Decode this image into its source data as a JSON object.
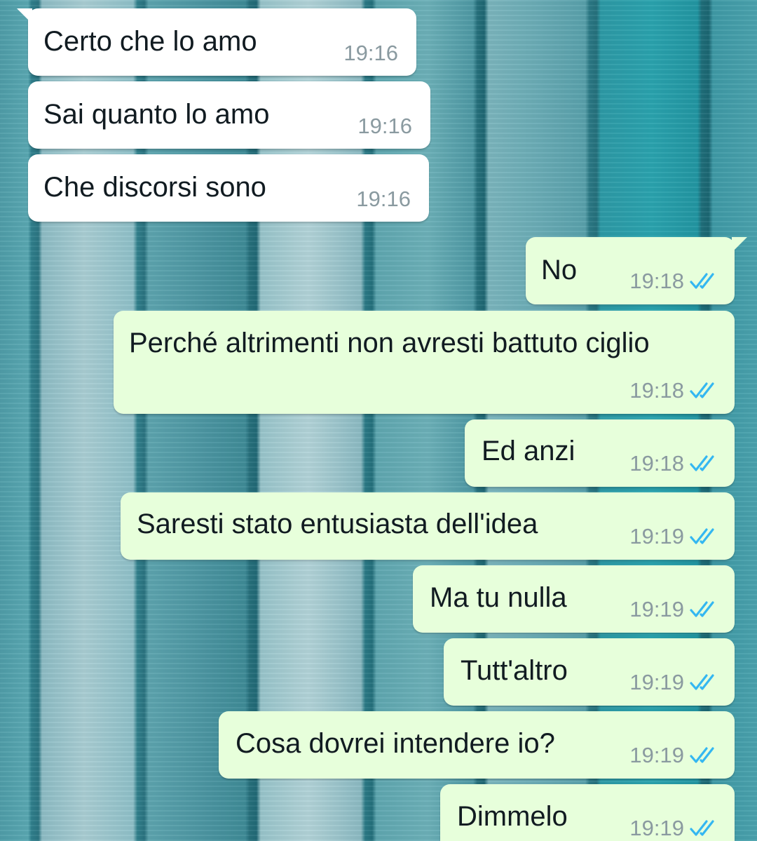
{
  "conversation": {
    "messages": [
      {
        "direction": "in",
        "text": "Certo che lo amo",
        "time": "19:16"
      },
      {
        "direction": "in",
        "text": "Sai quanto lo amo",
        "time": "19:16"
      },
      {
        "direction": "in",
        "text": "Che discorsi sono",
        "time": "19:16"
      },
      {
        "direction": "out",
        "text": "No",
        "time": "19:18",
        "status": "read",
        "status_icon": "double-check-icon",
        "status_color": "#34b7f1"
      },
      {
        "direction": "out",
        "text": "Perché altrimenti non avresti battuto ciglio",
        "time": "19:18",
        "status": "read",
        "status_icon": "double-check-icon",
        "status_color": "#34b7f1"
      },
      {
        "direction": "out",
        "text": "Ed anzi",
        "time": "19:18",
        "status": "read",
        "status_icon": "double-check-icon",
        "status_color": "#34b7f1"
      },
      {
        "direction": "out",
        "text": "Saresti stato entusiasta dell'idea",
        "time": "19:19",
        "status": "read",
        "status_icon": "double-check-icon",
        "status_color": "#34b7f1"
      },
      {
        "direction": "out",
        "text": "Ma tu nulla",
        "time": "19:19",
        "status": "read",
        "status_icon": "double-check-icon",
        "status_color": "#34b7f1"
      },
      {
        "direction": "out",
        "text": "Tutt'altro",
        "time": "19:19",
        "status": "read",
        "status_icon": "double-check-icon",
        "status_color": "#34b7f1"
      },
      {
        "direction": "out",
        "text": "Cosa dovrei intendere io?",
        "time": "19:19",
        "status": "read",
        "status_icon": "double-check-icon",
        "status_color": "#34b7f1"
      },
      {
        "direction": "out",
        "text": "Dimmelo",
        "time": "19:19",
        "status": "read",
        "status_icon": "double-check-icon",
        "status_color": "#34b7f1"
      }
    ]
  },
  "colors": {
    "incoming_bubble": "#ffffff",
    "outgoing_bubble": "#e7ffdb",
    "read_tick": "#34b7f1",
    "timestamp": "#8a9aa0",
    "wallpaper": "#3f8e9a"
  }
}
